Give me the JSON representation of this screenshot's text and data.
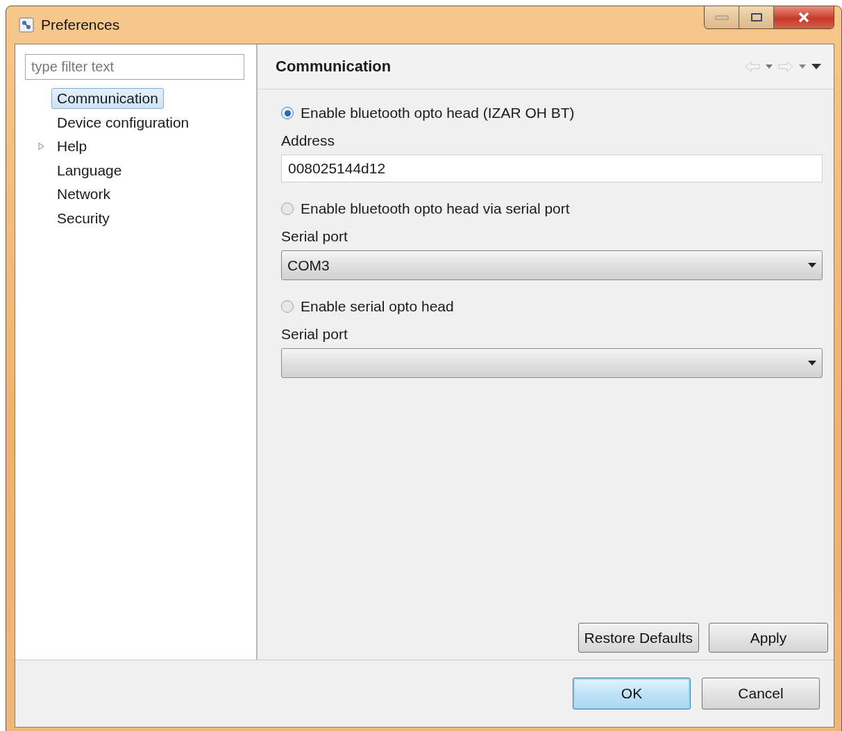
{
  "window": {
    "title": "Preferences"
  },
  "filter": {
    "placeholder": "type filter text"
  },
  "tree": {
    "items": [
      {
        "label": "Communication",
        "selected": true,
        "kind": "leaf"
      },
      {
        "label": "Device configuration",
        "selected": false,
        "kind": "leaf"
      },
      {
        "label": "Help",
        "selected": false,
        "kind": "group",
        "expanded": false
      },
      {
        "label": "Language",
        "selected": false,
        "kind": "leaf"
      },
      {
        "label": "Network",
        "selected": false,
        "kind": "leaf"
      },
      {
        "label": "Security",
        "selected": false,
        "kind": "leaf"
      }
    ]
  },
  "page": {
    "title": "Communication",
    "sections": [
      {
        "label": "Enable bluetooth opto head (IZAR OH BT)",
        "selected": true,
        "field_label": "Address",
        "field": {
          "kind": "text",
          "value": "008025144d12"
        }
      },
      {
        "label": "Enable bluetooth opto head via serial port",
        "selected": false,
        "field_label": "Serial port",
        "field": {
          "kind": "combo",
          "value": "COM3"
        }
      },
      {
        "label": "Enable serial opto head",
        "selected": false,
        "field_label": "Serial port",
        "field": {
          "kind": "combo"
        }
      }
    ],
    "buttons": [
      "Restore Defaults",
      "Apply"
    ]
  },
  "dialog_buttons": [
    {
      "label": "OK",
      "default": true
    },
    {
      "label": "Cancel",
      "default": false
    }
  ]
}
